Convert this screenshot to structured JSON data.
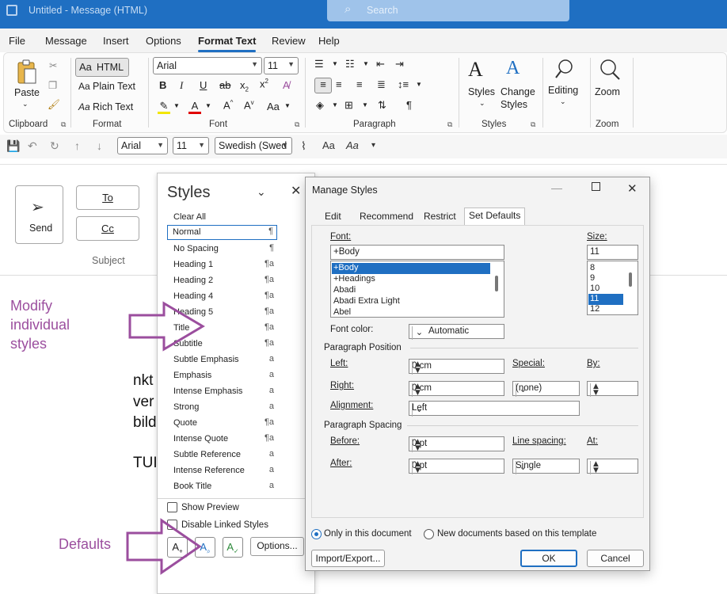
{
  "window": {
    "title": "Untitled  -  Message (HTML)",
    "search_placeholder": "Search"
  },
  "menu": [
    "File",
    "Message",
    "Insert",
    "Options",
    "Format Text",
    "Review",
    "Help"
  ],
  "menu_active": "Format Text",
  "ribbon": {
    "clipboard": {
      "paste_label": "Paste",
      "group": "Clipboard"
    },
    "format": {
      "html": "HTML",
      "plain": "Plain Text",
      "rich": "Rich Text",
      "group": "Format"
    },
    "font": {
      "face": "Arial",
      "size": "11",
      "group": "Font"
    },
    "paragraph": {
      "group": "Paragraph"
    },
    "styles": {
      "styles_label": "Styles",
      "change_styles_1": "Change",
      "change_styles_2": "Styles",
      "group": "Styles"
    },
    "editing": {
      "label": "Editing"
    },
    "zoom": {
      "label": "Zoom",
      "group": "Zoom"
    }
  },
  "qat": {
    "font": "Arial",
    "size": "11",
    "language": "Swedish (Swed"
  },
  "compose": {
    "send": "Send",
    "to": "To",
    "cc": "Cc",
    "subject": "Subject",
    "body_lines": [
      "nkt",
      "ver",
      "bild",
      "TUI"
    ]
  },
  "annotations": {
    "modify": [
      "Modify",
      "individual",
      "styles"
    ],
    "defaults": "Defaults",
    "accent_color": "#9b4e9e"
  },
  "styles_pane": {
    "title": "Styles",
    "items": [
      {
        "name": "Clear All",
        "mark": ""
      },
      {
        "name": "Normal",
        "mark": "¶"
      },
      {
        "name": "No Spacing",
        "mark": "¶"
      },
      {
        "name": "Heading 1",
        "mark": "¶a"
      },
      {
        "name": "Heading 2",
        "mark": "¶a"
      },
      {
        "name": "Heading 4",
        "mark": "¶a"
      },
      {
        "name": "Heading 5",
        "mark": "¶a"
      },
      {
        "name": "Title",
        "mark": "¶a"
      },
      {
        "name": "Subtitle",
        "mark": "¶a"
      },
      {
        "name": "Subtle Emphasis",
        "mark": "a"
      },
      {
        "name": "Emphasis",
        "mark": "a"
      },
      {
        "name": "Intense Emphasis",
        "mark": "a"
      },
      {
        "name": "Strong",
        "mark": "a"
      },
      {
        "name": "Quote",
        "mark": "¶a"
      },
      {
        "name": "Intense Quote",
        "mark": "¶a"
      },
      {
        "name": "Subtle Reference",
        "mark": "a"
      },
      {
        "name": "Intense Reference",
        "mark": "a"
      },
      {
        "name": "Book Title",
        "mark": "a"
      }
    ],
    "show_preview": "Show Preview",
    "disable_linked": "Disable Linked Styles",
    "options": "Options..."
  },
  "dialog": {
    "title": "Manage Styles",
    "tabs": [
      "Edit",
      "Recommend",
      "Restrict",
      "Set Defaults"
    ],
    "active_tab": "Set Defaults",
    "font_label": "Font:",
    "font_value": "+Body",
    "font_list": [
      "+Body",
      "+Headings",
      "Abadi",
      "Abadi Extra Light",
      "Abel"
    ],
    "size_label": "Size:",
    "size_value": "11",
    "size_list": [
      "8",
      "9",
      "10",
      "11",
      "12"
    ],
    "font_color_label": "Font color:",
    "font_color_value": "Automatic",
    "para_position": "Paragraph Position",
    "left_label": "Left:",
    "left_value": "0 cm",
    "special_label": "Special:",
    "by_label": "By:",
    "right_label": "Right:",
    "right_value": "0 cm",
    "special_value": "(none)",
    "alignment_label": "Alignment:",
    "alignment_value": "Left",
    "para_spacing": "Paragraph Spacing",
    "before_label": "Before:",
    "before_value": "0 pt",
    "line_spacing_label": "Line spacing:",
    "at_label": "At:",
    "after_label": "After:",
    "after_value": "0 pt",
    "line_spacing_value": "Single",
    "only_this_doc": "Only in this document",
    "new_docs": "New documents based on this template",
    "import_export": "Import/Export...",
    "ok": "OK",
    "cancel": "Cancel"
  }
}
